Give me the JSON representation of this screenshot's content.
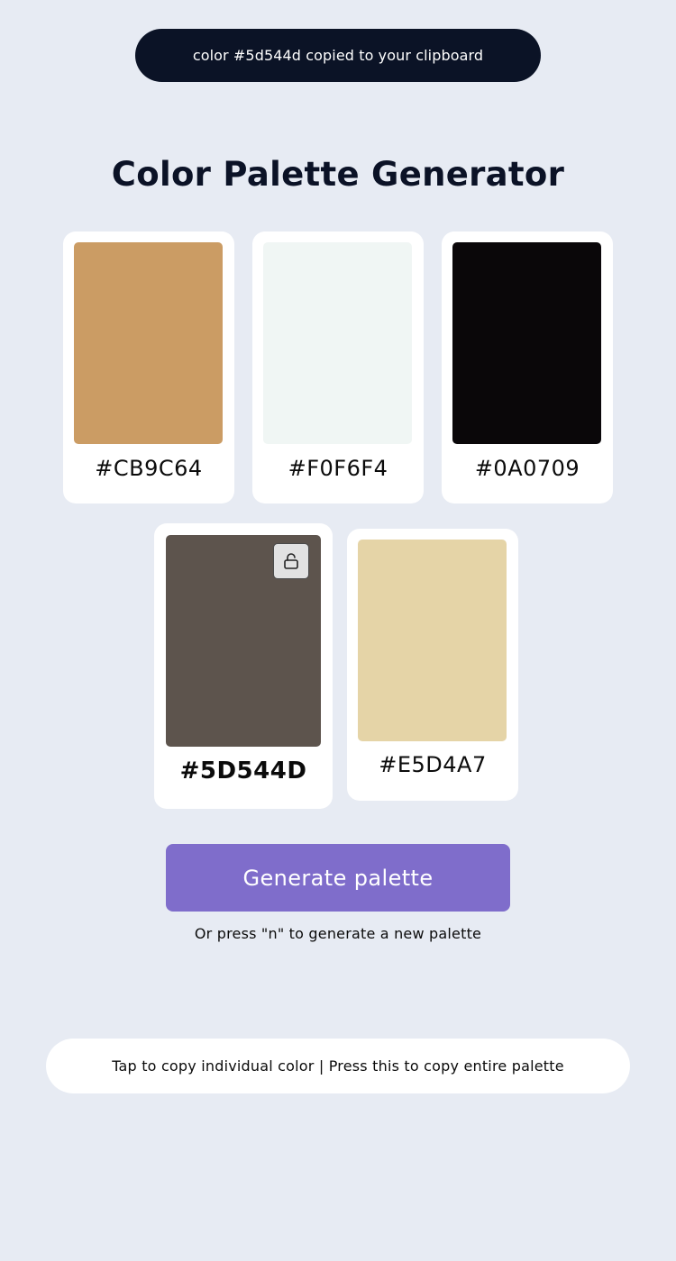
{
  "toast": {
    "message": "color #5d544d copied to your clipboard"
  },
  "page": {
    "title": "Color Palette Generator"
  },
  "palette": [
    {
      "hex_label": "#CB9C64",
      "color": "#cb9c64",
      "locked": false
    },
    {
      "hex_label": "#F0F6F4",
      "color": "#f0f6f4",
      "locked": false
    },
    {
      "hex_label": "#0A0709",
      "color": "#0a0709",
      "locked": false
    },
    {
      "hex_label": "#5D544D",
      "color": "#5d544d",
      "locked": true,
      "lock_icon": "unlock-icon"
    },
    {
      "hex_label": "#E5D4A7",
      "color": "#e5d4a7",
      "locked": false
    }
  ],
  "generate": {
    "button_label": "Generate palette",
    "hint": "Or press \"n\" to generate a new palette"
  },
  "copy_bar": {
    "label": "Tap to copy individual color | Press this to copy entire palette"
  },
  "colors": {
    "background": "#e7ebf3",
    "toast_background": "#0b1326",
    "accent": "#7f6dcb",
    "card": "#ffffff"
  }
}
